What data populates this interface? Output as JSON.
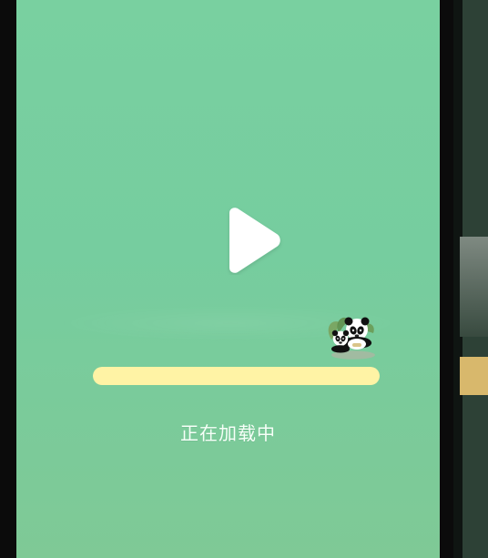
{
  "screen": {
    "loading_text": "正在加载中",
    "progress_fraction": 1.0
  },
  "icons": {
    "play": "play-icon",
    "mascot": "panda-mascot-icon"
  },
  "colors": {
    "screen_top": "#79d0a0",
    "screen_bottom": "#7fc996",
    "progress_fill": "#fff3a5",
    "side_panel": "#2d4136"
  }
}
